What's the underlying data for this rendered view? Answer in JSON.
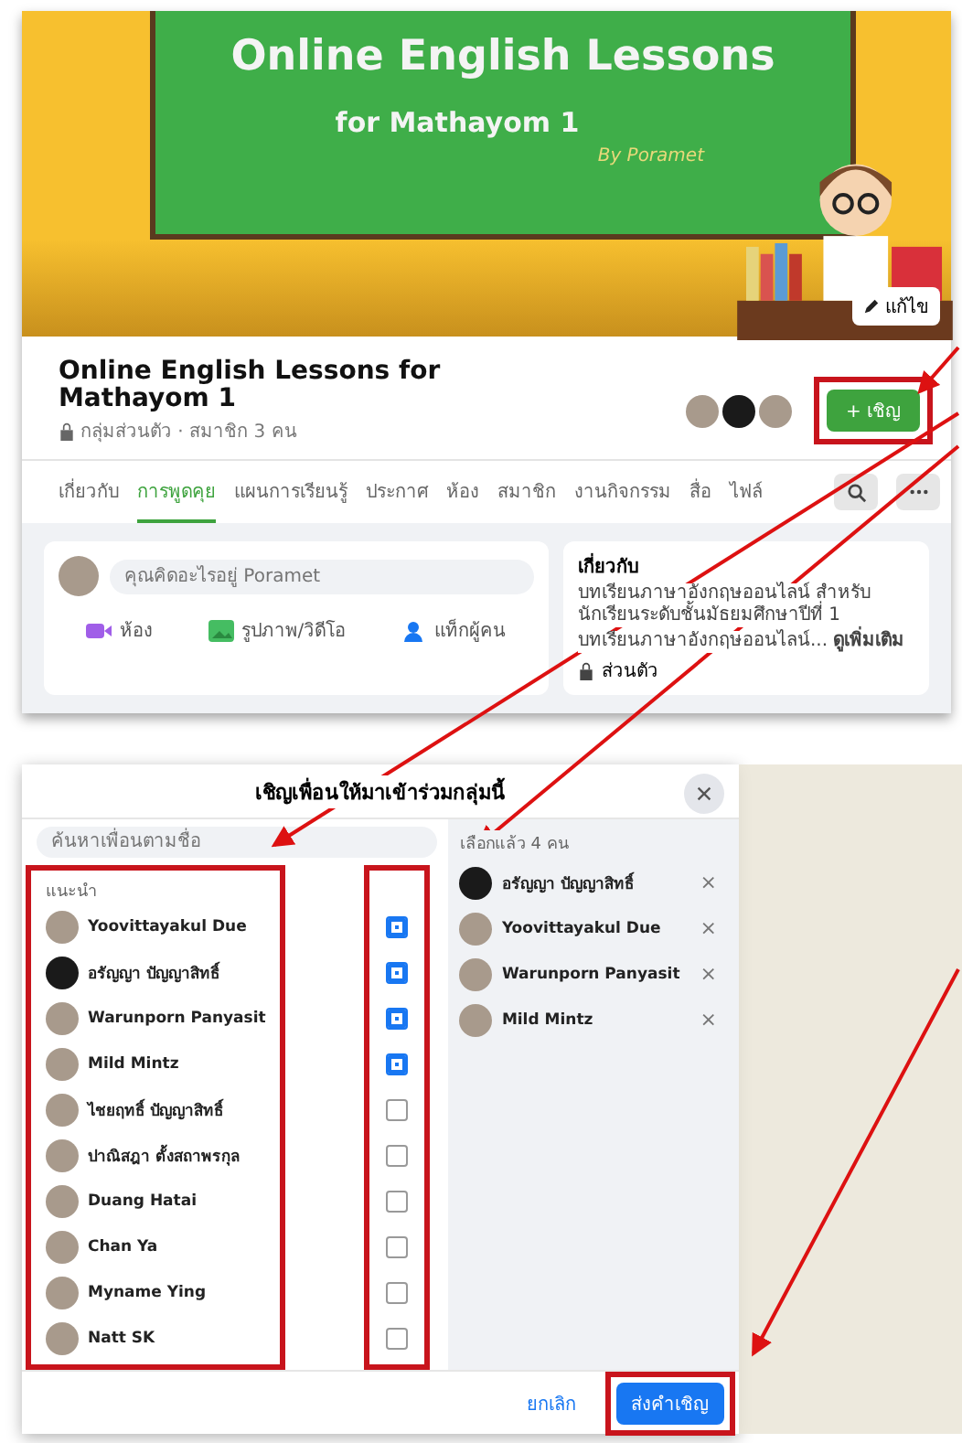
{
  "group_page": {
    "cover": {
      "headline": "Online English Lessons",
      "subline": "for Mathayom 1",
      "byline": "By Poramet",
      "edit_button": "แก้ไข"
    },
    "title": "Online English Lessons for Mathayom 1",
    "subtitle": "กลุ่มส่วนตัว · สมาชิก 3 คน",
    "invite_button": "+ เชิญ",
    "tabs": [
      {
        "label": "เกี่ยวกับ",
        "selected": false
      },
      {
        "label": "การพูดคุย",
        "selected": true
      },
      {
        "label": "แผนการเรียนรู้",
        "selected": false
      },
      {
        "label": "ประกาศ",
        "selected": false
      },
      {
        "label": "ห้อง",
        "selected": false
      },
      {
        "label": "สมาชิก",
        "selected": false
      },
      {
        "label": "งานกิจกรรม",
        "selected": false
      },
      {
        "label": "สื่อ",
        "selected": false
      },
      {
        "label": "ไฟล์",
        "selected": false
      }
    ],
    "composer": {
      "placeholder": "คุณคิดอะไรอยู่ Poramet",
      "actions": [
        {
          "label": "ห้อง",
          "kind": "room"
        },
        {
          "label": "รูปภาพ/วิดีโอ",
          "kind": "photo"
        },
        {
          "label": "แท็กผู้คน",
          "kind": "tag"
        }
      ]
    },
    "about": {
      "heading": "เกี่ยวกับ",
      "lines": [
        "บทเรียนภาษาอังกฤษออนไลน์ สำหรับนักเรียนระดับชั้นมัธยมศึกษาปีที่ 1",
        "บทเรียนภาษาอังกฤษออนไลน์... **ดูเพิ่มเติม**"
      ],
      "privacy": "ส่วนตัว"
    }
  },
  "invite_dialog": {
    "title": "เชิญเพื่อนให้มาเข้าร่วมกลุ่มนี้",
    "search_placeholder": "ค้นหาเพื่อนตามชื่อ",
    "section": "แนะนำ",
    "friends": [
      {
        "name": "Yoovittayakul Due",
        "checked": true
      },
      {
        "name": "อรัญญา ปัญญาสิทธิ์",
        "checked": true
      },
      {
        "name": "Warunporn Panyasit",
        "checked": true
      },
      {
        "name": "Mild Mintz",
        "checked": true
      },
      {
        "name": "ไชยฤทธิ์ ปัญญาสิทธิ์",
        "checked": false
      },
      {
        "name": "ปาณิสฎา ตั้งสถาพรกุล",
        "checked": false
      },
      {
        "name": "Duang Hatai",
        "checked": false
      },
      {
        "name": "Chan Ya",
        "checked": false
      },
      {
        "name": "Myname Ying",
        "checked": false
      },
      {
        "name": "Natt SK",
        "checked": false
      }
    ],
    "selected_header": "เลือกแล้ว 4 คน",
    "selected": [
      {
        "name": "อรัญญา ปัญญาสิทธิ์",
        "remove": "×"
      },
      {
        "name": "Yoovittayakul Due",
        "remove": "×"
      },
      {
        "name": "Warunporn Panyasit",
        "remove": "×"
      },
      {
        "name": "Mild Mintz",
        "remove": "×"
      }
    ],
    "cancel_button": "ยกเลิก",
    "send_button": "ส่งคำเชิญ"
  }
}
